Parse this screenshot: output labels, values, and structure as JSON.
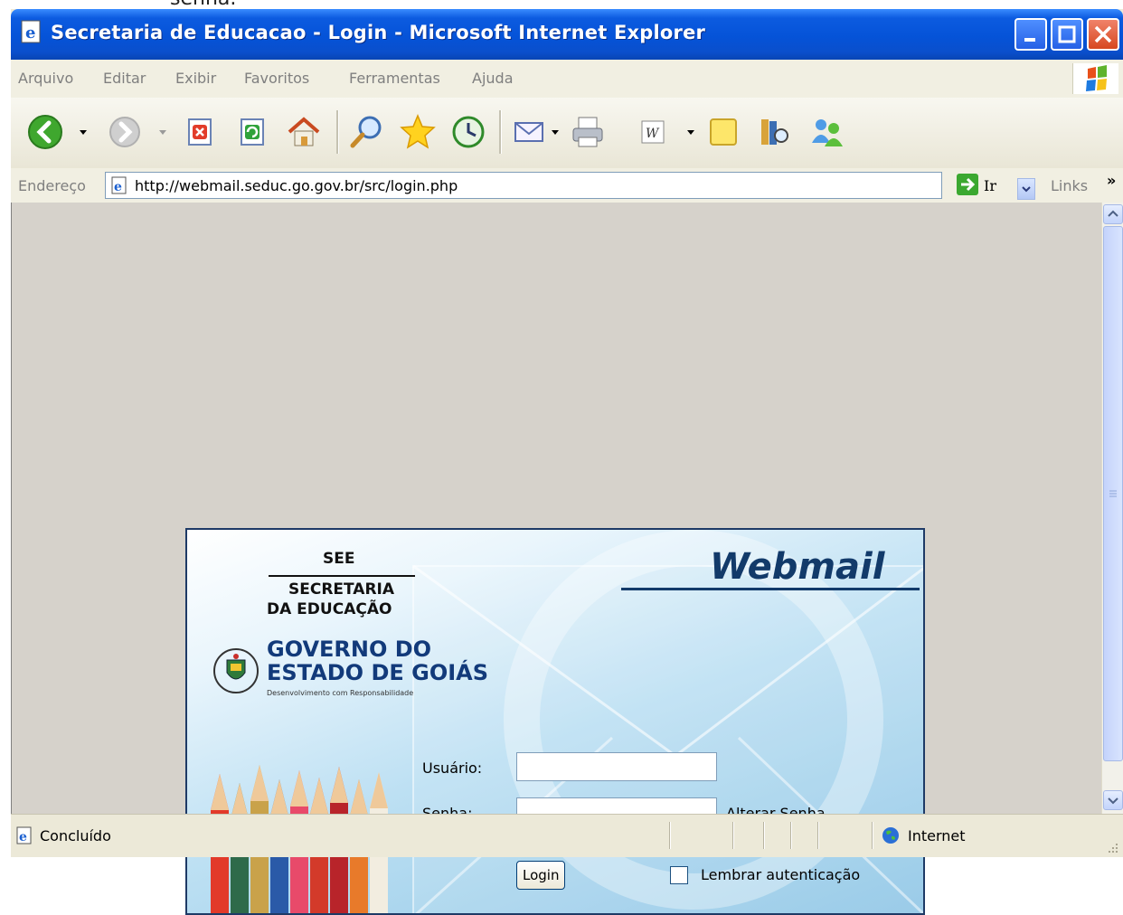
{
  "caption": {
    "text": "senha."
  },
  "window": {
    "title": "Secretaria de Educacao - Login - Microsoft Internet Explorer",
    "colors": {
      "titlebar": "#0553d8",
      "close_button": "#d7481f"
    }
  },
  "menu": {
    "items": [
      "Arquivo",
      "Editar",
      "Exibir",
      "Favoritos",
      "Ferramentas",
      "Ajuda"
    ]
  },
  "toolbar": {
    "icons": [
      "back-icon",
      "forward-icon",
      "stop-icon",
      "refresh-icon",
      "home-icon",
      "search-icon",
      "favorites-icon",
      "history-icon",
      "mail-icon",
      "print-icon",
      "edit-icon",
      "discuss-icon",
      "research-icon",
      "messenger-icon"
    ]
  },
  "address": {
    "label": "Endereço",
    "url": "http://webmail.seduc.go.gov.br/src/login.php",
    "go_label": "Ir",
    "links_label": "Links",
    "chevron": "»"
  },
  "page": {
    "background": "#d6d2cb",
    "brand": {
      "see": "SEE",
      "secretaria_line1": "SECRETARIA",
      "secretaria_line2": "DA EDUCAÇÃO",
      "gov_line1": "GOVERNO DO",
      "gov_line2": "ESTADO DE GOIÁS",
      "gov_tagline": "Desenvolvimento com Responsabilidade",
      "product": "Webmail"
    },
    "form": {
      "user_label": "Usuário:",
      "user_value": "",
      "pass_label": "Senha:",
      "pass_value": "",
      "change_password": "Alterar Senha",
      "login_button": "Login",
      "remember_label": "Lembrar autenticação",
      "remember_checked": false
    }
  },
  "status": {
    "text": "Concluído",
    "zone": "Internet"
  }
}
